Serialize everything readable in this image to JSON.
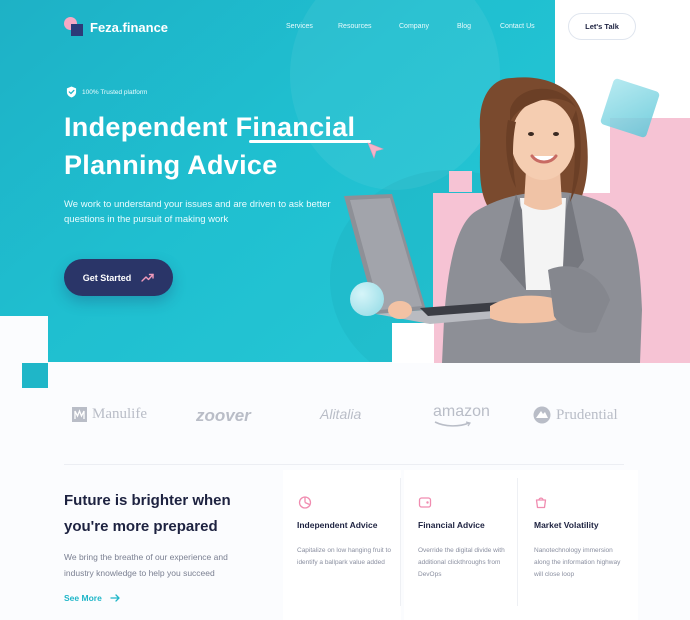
{
  "brand": {
    "name": "Feza.finance"
  },
  "nav": {
    "items": [
      "Services",
      "Resources",
      "Company",
      "Blog",
      "Contact Us"
    ],
    "cta": "Let's Talk"
  },
  "hero": {
    "badge": "100% Trusted platform",
    "title_part1": "Independent ",
    "title_highlight": "Financial",
    "title_line2": "Planning Advice",
    "subtitle": "We work to understand your issues and are driven to ask better questions in the pursuit of making work",
    "cta": "Get Started"
  },
  "partners": [
    "Manulife",
    "zoover",
    "Alitalia",
    "amazon",
    "Prudential"
  ],
  "section": {
    "heading": "Future is brighter when you're more prepared",
    "text": "We bring the breathe of our experience and industry knowledge to help you succeed",
    "link": "See More"
  },
  "features": [
    {
      "icon": "pie-chart-icon",
      "title": "Independent Advice",
      "text": "Capitalize on low hanging fruit to identify a ballpark value added"
    },
    {
      "icon": "wallet-icon",
      "title": "Financial Advice",
      "text": "Override the digital divide with additional clickthroughs from DevOps"
    },
    {
      "icon": "bag-icon",
      "title": "Market Volatility",
      "text": "Nanotechnology immersion along the information highway will close loop"
    }
  ],
  "colors": {
    "teal": "#1fb6c8",
    "navy": "#2a3568",
    "pink": "#f6c3d4"
  }
}
